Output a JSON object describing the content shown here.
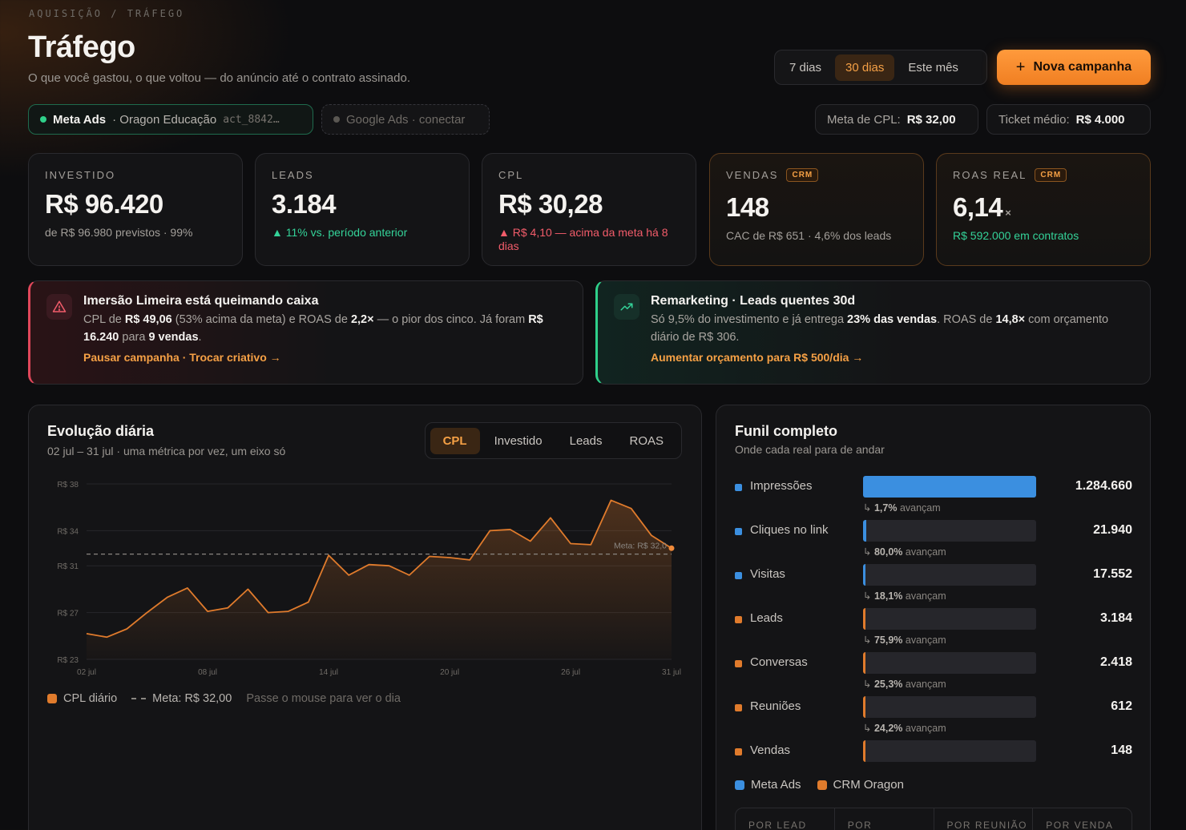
{
  "header": {
    "breadcrumb": "AQUISIÇÃO / TRÁFEGO",
    "title": "Tráfego",
    "subtitle": "O que você gastou, o que voltou — do anúncio até o contrato assinado."
  },
  "ranges": [
    "7 dias",
    "30 dias",
    "Este mês"
  ],
  "range_active": "30 dias",
  "new_campaign": {
    "icon": "plus-icon",
    "label": "Nova campanha"
  },
  "sources": {
    "meta": {
      "name": "Meta Ads",
      "org": "· Oragon Educação",
      "account": "act_8842…"
    },
    "google": {
      "label": "Google Ads · conectar"
    }
  },
  "targets": {
    "cpl_label": "Meta de CPL:",
    "cpl_value": "R$ 32,00",
    "ticket_label": "Ticket médio:",
    "ticket_value": "R$ 4.000"
  },
  "kpis": [
    {
      "label": "INVESTIDO",
      "value": "R$ 96.420",
      "note": "de R$ 96.980 previstos · 99%"
    },
    {
      "label": "LEADS",
      "value": "3.184",
      "note": "▲ 11% vs. período anterior"
    },
    {
      "label": "CPL",
      "value": "R$ 30,28",
      "note": "▲ R$ 4,10 — acima da meta há 8 dias"
    },
    {
      "label": "VENDAS",
      "badge": "CRM",
      "value": "148",
      "note": "CAC de R$ 651 · 4,6% dos leads"
    },
    {
      "label": "ROAS REAL",
      "badge": "CRM",
      "value": "6,14",
      "suffix": "×",
      "note": "R$ 592.000 em contratos"
    }
  ],
  "alerts": {
    "burn": {
      "icon": "warning-icon",
      "title": "Imersão Limeira está queimando caixa",
      "p1": "CPL de ",
      "b1": "R$ 49,06",
      "p2": " (53% acima da meta) e ROAS de ",
      "b2": "2,2×",
      "p3": " — o pior dos cinco. Já foram ",
      "b3": "R$ 16.240",
      "p4": " para ",
      "b4": "9 vendas",
      "p5": ".",
      "action": "Pausar campanha · Trocar criativo →"
    },
    "remarketing": {
      "icon": "trending-up-icon",
      "title": "Remarketing · Leads quentes 30d",
      "p1": "Só 9,5% do investimento e já entrega ",
      "b1": "23% das vendas",
      "p2": ". ROAS de ",
      "b2": "14,8×",
      "p3": " com orçamento diário de R$ 306.",
      "action": "Aumentar orçamento para R$ 500/dia →"
    }
  },
  "evolution": {
    "title": "Evolução diária",
    "subtitle": "02 jul – 31 jul · uma métrica por vez, um eixo só",
    "tabs": [
      "CPL",
      "Investido",
      "Leads",
      "ROAS"
    ],
    "tab_active": "CPL",
    "legend_series": "CPL diário",
    "legend_target": "Meta: R$ 32,00",
    "legend_hint": "Passe o mouse para ver o dia"
  },
  "chart_data": {
    "type": "area",
    "x_ticks": [
      "02 jul",
      "08 jul",
      "14 jul",
      "20 jul",
      "26 jul",
      "31 jul"
    ],
    "y_ticks": [
      "R$ 23",
      "R$ 27",
      "R$ 31",
      "R$ 34",
      "R$ 38"
    ],
    "ylim": [
      23,
      38
    ],
    "x": [
      "02 jul",
      "03 jul",
      "04 jul",
      "05 jul",
      "06 jul",
      "07 jul",
      "08 jul",
      "09 jul",
      "10 jul",
      "11 jul",
      "12 jul",
      "13 jul",
      "14 jul",
      "15 jul",
      "16 jul",
      "17 jul",
      "18 jul",
      "19 jul",
      "20 jul",
      "21 jul",
      "22 jul",
      "23 jul",
      "24 jul",
      "25 jul",
      "26 jul",
      "27 jul",
      "28 jul",
      "29 jul",
      "30 jul",
      "31 jul"
    ],
    "series": [
      {
        "name": "CPL diário",
        "color": "#e07b2c",
        "values": [
          25.2,
          24.9,
          25.6,
          27.0,
          28.3,
          29.1,
          27.1,
          27.4,
          29.0,
          27.0,
          27.1,
          27.9,
          31.9,
          30.2,
          31.1,
          31.0,
          30.2,
          31.8,
          31.7,
          31.5,
          34.0,
          34.1,
          33.1,
          35.1,
          32.9,
          32.8,
          36.6,
          35.9,
          33.6,
          32.5
        ]
      }
    ],
    "target": {
      "label": "Meta: R$ 32,0",
      "value": 32.0
    },
    "grid": true
  },
  "funnel": {
    "title": "Funil completo",
    "subtitle": "Onde cada real para de andar",
    "rows": [
      {
        "name": "Impressões",
        "value": "1.284.660",
        "count": 1284660,
        "source": "meta",
        "conv": "1,7%",
        "conv_label": "avançam"
      },
      {
        "name": "Cliques no link",
        "value": "21.940",
        "count": 21940,
        "source": "meta",
        "conv": "80,0%",
        "conv_label": "avançam"
      },
      {
        "name": "Visitas",
        "value": "17.552",
        "count": 17552,
        "source": "meta",
        "conv": "18,1%",
        "conv_label": "avançam"
      },
      {
        "name": "Leads",
        "value": "3.184",
        "count": 3184,
        "source": "crm",
        "conv": "75,9%",
        "conv_label": "avançam"
      },
      {
        "name": "Conversas",
        "value": "2.418",
        "count": 2418,
        "source": "crm",
        "conv": "25,3%",
        "conv_label": "avançam"
      },
      {
        "name": "Reuniões",
        "value": "612",
        "count": 612,
        "source": "crm",
        "conv": "24,2%",
        "conv_label": "avançam"
      },
      {
        "name": "Vendas",
        "value": "148",
        "count": 148,
        "source": "crm",
        "conv": "",
        "conv_label": ""
      }
    ],
    "legend": [
      "Meta Ads",
      "CRM Oragon"
    ],
    "colors": {
      "meta": "#3b8fe0",
      "crm": "#e07b2c"
    },
    "cost_headers": [
      "POR LEAD",
      "POR",
      "POR REUNIÃO",
      "POR VENDA"
    ]
  }
}
